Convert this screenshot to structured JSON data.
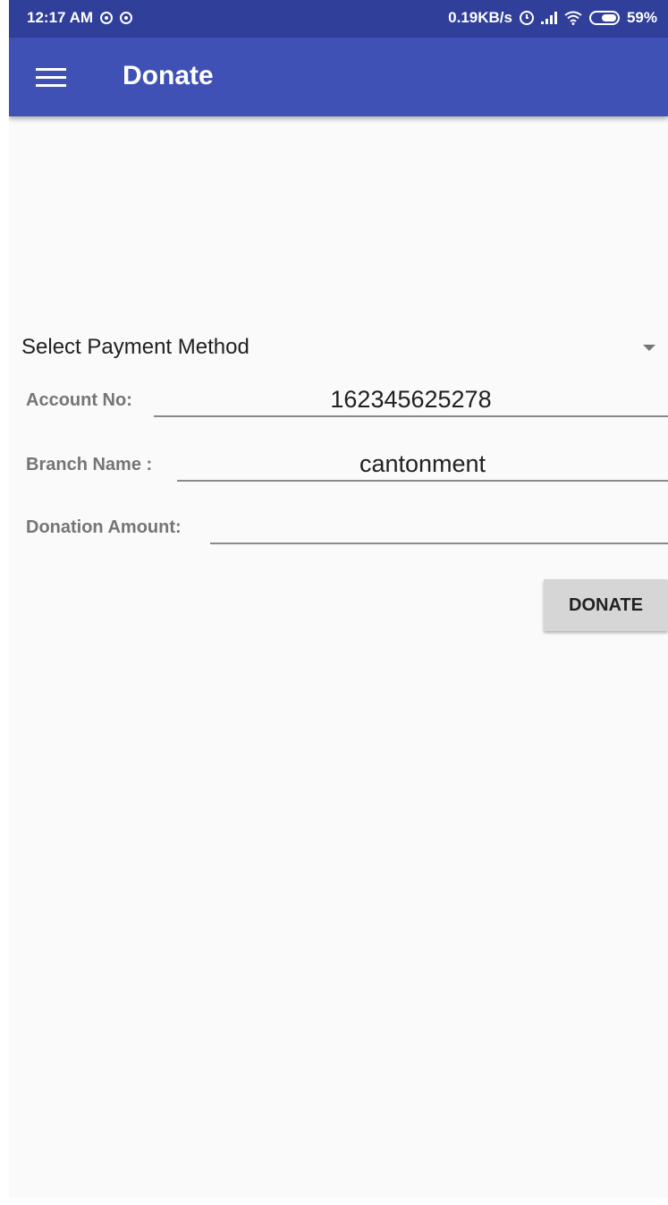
{
  "status_bar": {
    "time": "12:17 AM",
    "network_speed": "0.19KB/s",
    "battery": "59%",
    "icons": [
      "notification-icon",
      "notification-icon",
      "alarm-icon",
      "signal-icon",
      "wifi-icon",
      "battery-icon"
    ]
  },
  "app_bar": {
    "title": "Donate",
    "background": "#3f51b5",
    "menu_icon": "menu-icon"
  },
  "form": {
    "payment_method": {
      "label": "Select Payment Method"
    },
    "account_no": {
      "label": "Account No:",
      "value": "162345625278"
    },
    "branch_name": {
      "label": "Branch Name :",
      "value": "cantonment"
    },
    "donation_amount": {
      "label": "Donation Amount:",
      "value": ""
    },
    "donate_label": "DONATE"
  }
}
